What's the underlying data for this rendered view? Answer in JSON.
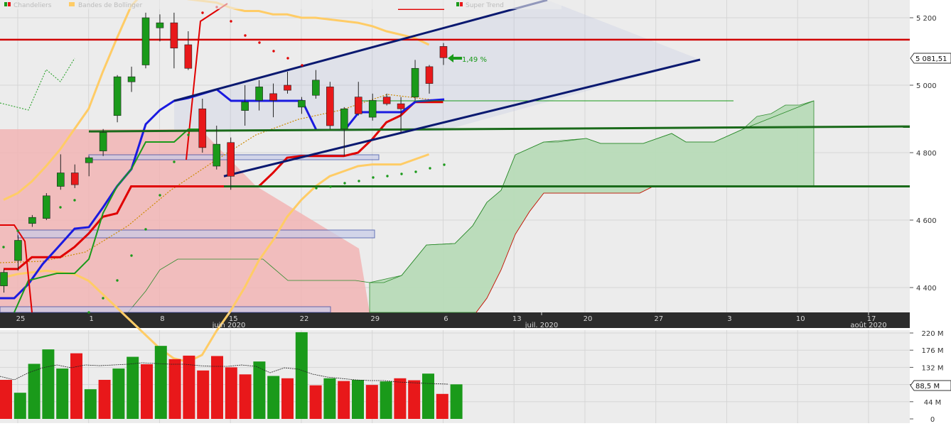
{
  "legend": [
    {
      "label": "Chandeliers",
      "icon": "red-green-squares-icon"
    },
    {
      "label": "Bandes de Bollinger",
      "icon": "orange-square-icon"
    },
    {
      "label": "Super Trend",
      "icon": "red-green-squares-icon"
    }
  ],
  "price_tag": "5 081,51",
  "volume_tag": "88,5 M",
  "change_annotation": "1,49 %",
  "colors": {
    "up": "#1a9a1a",
    "down": "#e8181a",
    "bollinger": "#ffcc66",
    "supertrend": "#e00000",
    "trendline": "#0a1970",
    "support": "#1a6a1a",
    "cloud_bull": "#b9dcb9",
    "cloud_bear": "#f2b1b1"
  },
  "chart_data": [
    {
      "type": "candlestick",
      "x_ticks": [
        "25",
        "1",
        "8",
        "15",
        "22",
        "29",
        "6",
        "13",
        "20",
        "27",
        "3",
        "10",
        "17"
      ],
      "x_month_labels": [
        "juin 2020",
        "juil. 2020",
        "août 2020"
      ],
      "y_ticks": [
        "5 200",
        "5 000",
        "4 800",
        "4 600",
        "4 400"
      ],
      "ylim": [
        4330,
        5250
      ],
      "candles": [
        {
          "o": 4405,
          "h": 4455,
          "l": 4385,
          "c": 4445
        },
        {
          "o": 4480,
          "h": 4555,
          "l": 4450,
          "c": 4540
        },
        {
          "o": 4590,
          "h": 4615,
          "l": 4580,
          "c": 4608
        },
        {
          "o": 4605,
          "h": 4680,
          "l": 4600,
          "c": 4672
        },
        {
          "o": 4700,
          "h": 4795,
          "l": 4690,
          "c": 4740
        },
        {
          "o": 4740,
          "h": 4765,
          "l": 4695,
          "c": 4705
        },
        {
          "o": 4770,
          "h": 4790,
          "l": 4730,
          "c": 4785
        },
        {
          "o": 4805,
          "h": 4870,
          "l": 4790,
          "c": 4860
        },
        {
          "o": 4910,
          "h": 5030,
          "l": 4890,
          "c": 5025
        },
        {
          "o": 5010,
          "h": 5055,
          "l": 4980,
          "c": 5025
        },
        {
          "o": 5060,
          "h": 5215,
          "l": 5050,
          "c": 5200
        },
        {
          "o": 5170,
          "h": 5210,
          "l": 5130,
          "c": 5185
        },
        {
          "o": 5185,
          "h": 5215,
          "l": 5050,
          "c": 5110
        },
        {
          "o": 5120,
          "h": 5160,
          "l": 5045,
          "c": 5050
        },
        {
          "o": 4930,
          "h": 4960,
          "l": 4800,
          "c": 4815
        },
        {
          "o": 4760,
          "h": 4880,
          "l": 4750,
          "c": 4825
        },
        {
          "o": 4830,
          "h": 4845,
          "l": 4690,
          "c": 4730
        },
        {
          "o": 4925,
          "h": 5000,
          "l": 4880,
          "c": 4950
        },
        {
          "o": 4955,
          "h": 5015,
          "l": 4925,
          "c": 4995
        },
        {
          "o": 4975,
          "h": 5005,
          "l": 4905,
          "c": 4955
        },
        {
          "o": 5000,
          "h": 5040,
          "l": 4975,
          "c": 4985
        },
        {
          "o": 4935,
          "h": 4965,
          "l": 4915,
          "c": 4955
        },
        {
          "o": 4970,
          "h": 5045,
          "l": 4960,
          "c": 5015
        },
        {
          "o": 4995,
          "h": 5010,
          "l": 4870,
          "c": 4880
        },
        {
          "o": 4870,
          "h": 4935,
          "l": 4790,
          "c": 4930
        },
        {
          "o": 4965,
          "h": 5010,
          "l": 4910,
          "c": 4915
        },
        {
          "o": 4905,
          "h": 4975,
          "l": 4895,
          "c": 4955
        },
        {
          "o": 4965,
          "h": 4975,
          "l": 4940,
          "c": 4945
        },
        {
          "o": 4945,
          "h": 4965,
          "l": 4860,
          "c": 4930
        },
        {
          "o": 4965,
          "h": 5075,
          "l": 4955,
          "c": 5050
        },
        {
          "o": 5055,
          "h": 5060,
          "l": 4975,
          "c": 5005
        },
        {
          "o": 5115,
          "h": 5125,
          "l": 5060,
          "c": 5081.51
        }
      ],
      "bollinger_upper": [
        4660,
        4680,
        4715,
        4760,
        4810,
        4870,
        4930,
        5040,
        5140,
        5235,
        5280,
        5300,
        5290,
        5255,
        5250,
        5245,
        5230,
        5220,
        5220,
        5210,
        5210,
        5200,
        5200,
        5195,
        5190,
        5185,
        5175,
        5160,
        5150,
        5140,
        5120
      ],
      "bollinger_lower": [
        4430,
        4440,
        4445,
        4450,
        4445,
        4440,
        4420,
        4380,
        4340,
        4300,
        4260,
        4220,
        4190,
        4180,
        4200,
        4270,
        4330,
        4400,
        4480,
        4540,
        4610,
        4660,
        4700,
        4730,
        4745,
        4760,
        4765,
        4765,
        4765,
        4780,
        4795
      ],
      "supertrend": [
        4455,
        4455,
        4490,
        4490,
        4490,
        4520,
        4560,
        4610,
        4620,
        4700,
        4700,
        4700,
        4700,
        4700,
        4700,
        4700,
        4700,
        4700,
        4700,
        4740,
        4785,
        4790,
        4790,
        4790,
        4790,
        4800,
        4840,
        4890,
        4910,
        4950,
        4950,
        4950
      ],
      "trend_channel": [
        {
          "x1": "2020-06-11",
          "y1": 4950,
          "x2": "2020-07-08",
          "y2": 5255
        },
        {
          "x1": "2020-06-15",
          "y1": 4700,
          "x2": "2020-07-24",
          "y2": 5080
        }
      ],
      "support_lines": [
        4863,
        4700
      ],
      "resistance_line": 5135
    },
    {
      "type": "bar",
      "y_ticks": [
        "220 M",
        "176 M",
        "132 M",
        "88 M",
        "44 M",
        "0"
      ],
      "ylim": [
        0,
        220
      ],
      "volumes": [
        {
          "v": 100,
          "up": false
        },
        {
          "v": 67,
          "up": true
        },
        {
          "v": 141,
          "up": true
        },
        {
          "v": 178,
          "up": true
        },
        {
          "v": 129,
          "up": true
        },
        {
          "v": 168,
          "up": false
        },
        {
          "v": 76,
          "up": true
        },
        {
          "v": 100,
          "up": false
        },
        {
          "v": 129,
          "up": true
        },
        {
          "v": 159,
          "up": true
        },
        {
          "v": 140,
          "up": false
        },
        {
          "v": 187,
          "up": true
        },
        {
          "v": 153,
          "up": false
        },
        {
          "v": 162,
          "up": false
        },
        {
          "v": 124,
          "up": false
        },
        {
          "v": 161,
          "up": false
        },
        {
          "v": 132,
          "up": false
        },
        {
          "v": 114,
          "up": false
        },
        {
          "v": 147,
          "up": true
        },
        {
          "v": 110,
          "up": true
        },
        {
          "v": 104,
          "up": false
        },
        {
          "v": 222,
          "up": true
        },
        {
          "v": 86,
          "up": false
        },
        {
          "v": 104,
          "up": true
        },
        {
          "v": 97,
          "up": false
        },
        {
          "v": 100,
          "up": true
        },
        {
          "v": 87,
          "up": false
        },
        {
          "v": 96,
          "up": true
        },
        {
          "v": 104,
          "up": false
        },
        {
          "v": 99,
          "up": false
        },
        {
          "v": 116,
          "up": true
        },
        {
          "v": 64,
          "up": false
        },
        {
          "v": 88.5,
          "up": true
        }
      ]
    }
  ]
}
